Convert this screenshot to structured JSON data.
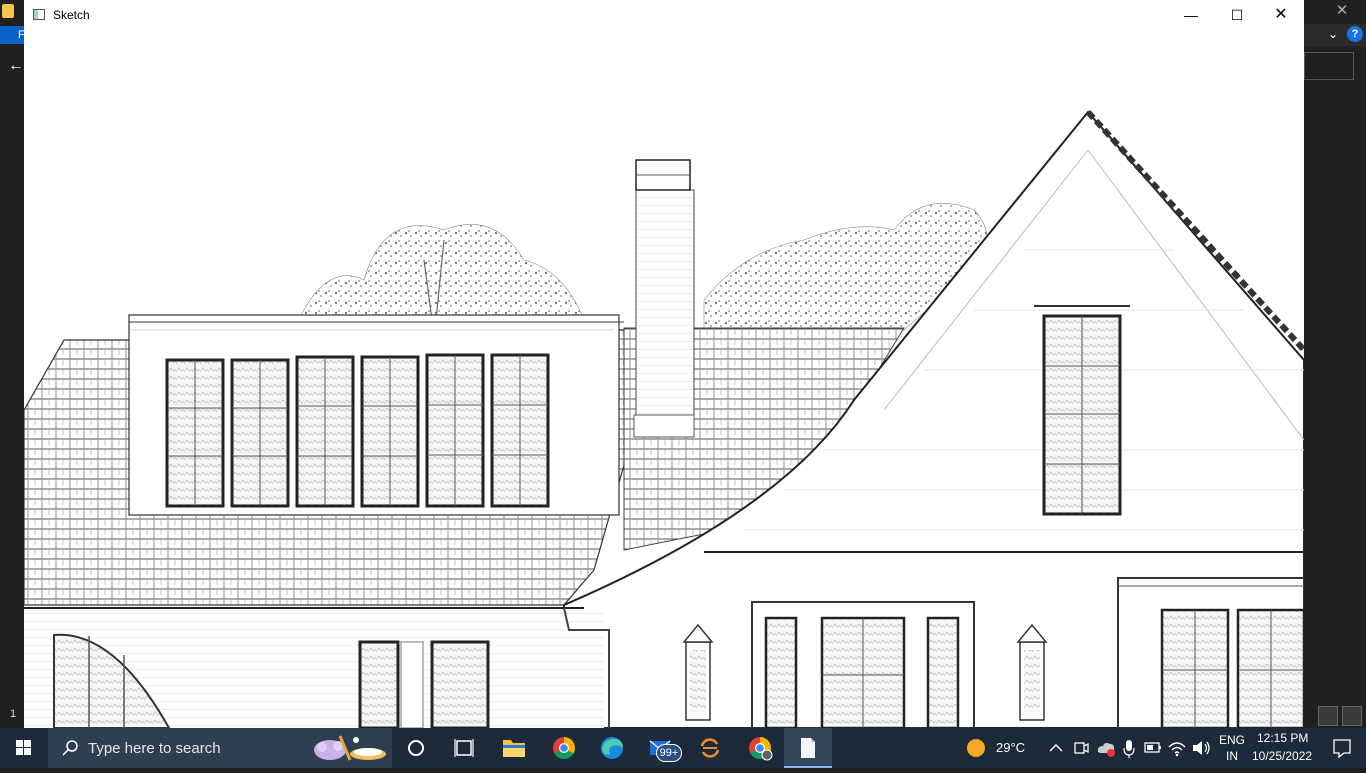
{
  "background_app": {
    "tab_letter": "F",
    "left_number": "1"
  },
  "window": {
    "title": "Sketch",
    "minimize_label": "—",
    "maximize_label": "☐",
    "close_label": "✕"
  },
  "image": {
    "description_icon": "house-sketch-image"
  },
  "taskbar": {
    "search_placeholder": "Type here to search",
    "mail_badge": "99+",
    "weather_temp": "29°C",
    "language_top": "ENG",
    "language_bottom": "IN",
    "time": "12:15 PM",
    "date": "10/25/2022"
  },
  "colors": {
    "taskbar_bg": "#1c2a3a",
    "search_bg": "#2f3f52",
    "accent": "#0078d4"
  }
}
